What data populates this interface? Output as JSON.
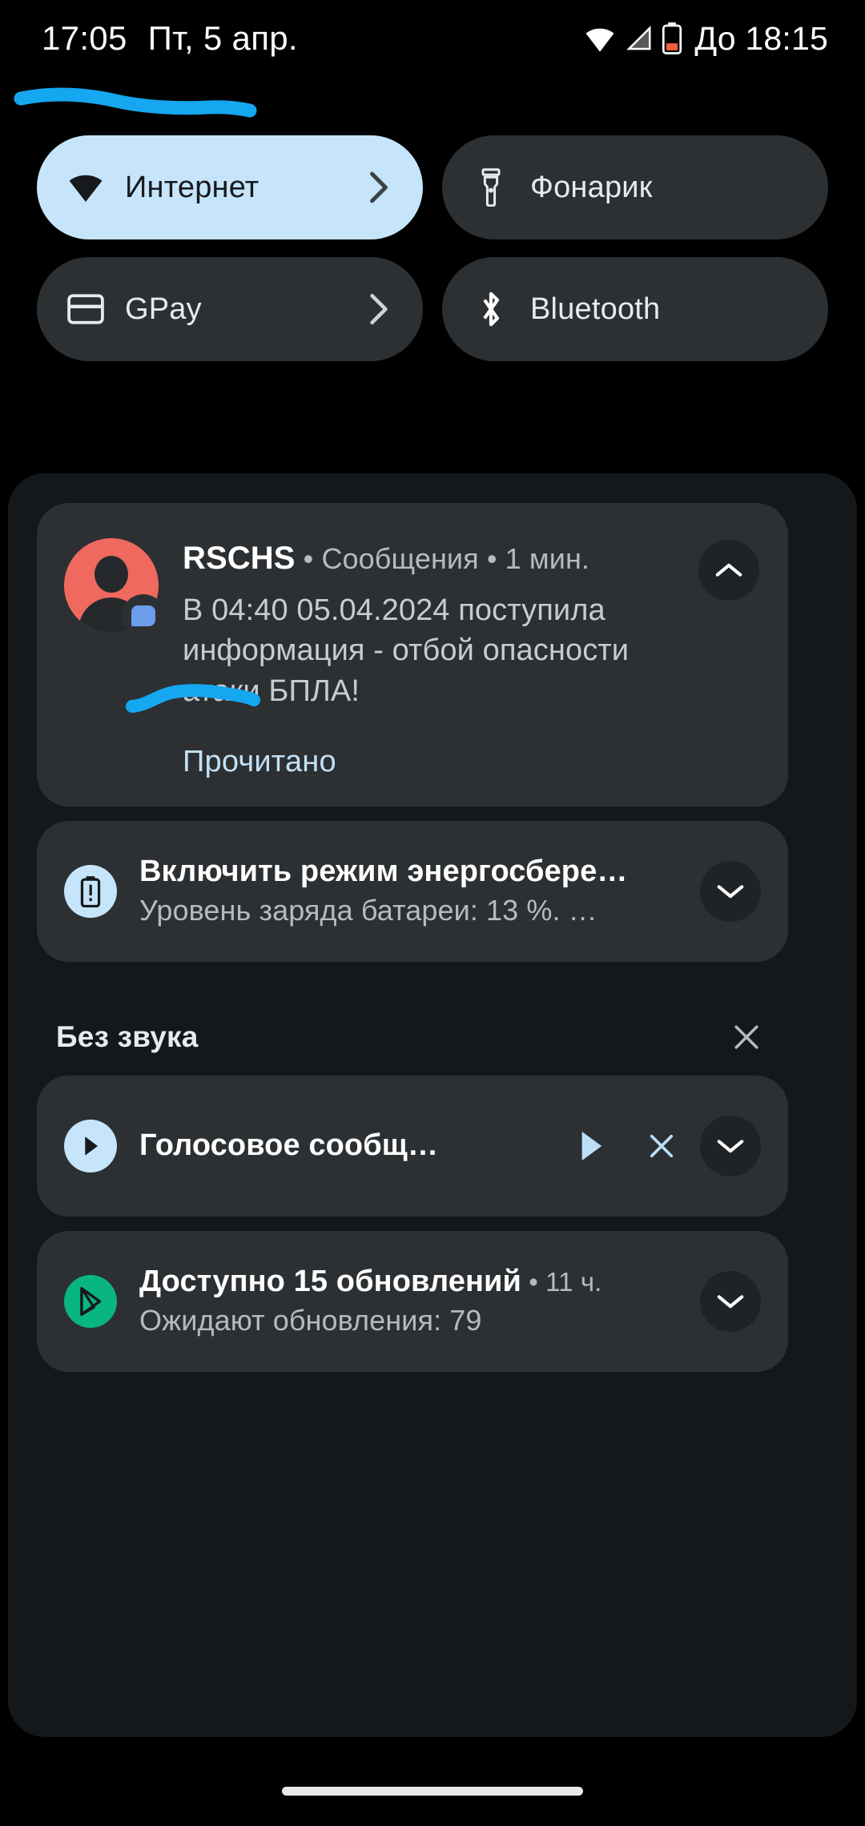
{
  "statusbar": {
    "clock": "17:05",
    "date": "Пт, 5 апр.",
    "battery_estimate": "До 18:15",
    "icons": [
      "wifi-icon",
      "signal-icon",
      "battery-low-icon"
    ]
  },
  "quick_settings": {
    "tiles": [
      {
        "label": "Интернет",
        "icon": "wifi-icon",
        "active": true,
        "has_chevron": true
      },
      {
        "label": "Фонарик",
        "icon": "flashlight-icon",
        "active": false,
        "has_chevron": false
      },
      {
        "label": "GPay",
        "icon": "credit-card-icon",
        "active": false,
        "has_chevron": true
      },
      {
        "label": "Bluetooth",
        "icon": "bluetooth-icon",
        "active": false,
        "has_chevron": false
      }
    ],
    "active_bg": "#c6e5fb",
    "inactive_bg": "#2c3033"
  },
  "notifications": {
    "conversation": {
      "app_name": "RSCHS",
      "channel": "Сообщения",
      "time": "1 мин.",
      "separator": " • ",
      "message": "В 04:40 05.04.2024 поступила информация - отбой опасности атаки БПЛА!",
      "action_label": "Прочитано",
      "avatar_color": "#f0695e",
      "badge_icon": "message-bubble-icon",
      "collapse_icon": "chevron-up-icon"
    },
    "battery_saver": {
      "title": "Включить режим энергосбере…",
      "subtitle": "Уровень заряда батареи: 13 %. …",
      "icon": "battery-alert-icon",
      "expand_icon": "chevron-down-icon"
    },
    "silent_section": {
      "title": "Без звука",
      "clear_icon": "close-icon",
      "items": [
        {
          "title": "Голосовое сообщ…",
          "icon": "play-circle-icon",
          "actions": [
            "play-icon",
            "close-icon"
          ],
          "expand_icon": "chevron-down-icon"
        },
        {
          "title": "Доступно 15 обновлений",
          "time": "11 ч.",
          "separator": " • ",
          "subtitle": "Ожидают обновления: 79",
          "icon": "play-store-icon",
          "expand_icon": "chevron-down-icon"
        }
      ]
    }
  },
  "annotations": {
    "color": "#15a7f0",
    "strokes": [
      "underline-status-bar",
      "underline-message-datetime"
    ]
  },
  "nav": {
    "gesture_pill": "home-indicator"
  }
}
